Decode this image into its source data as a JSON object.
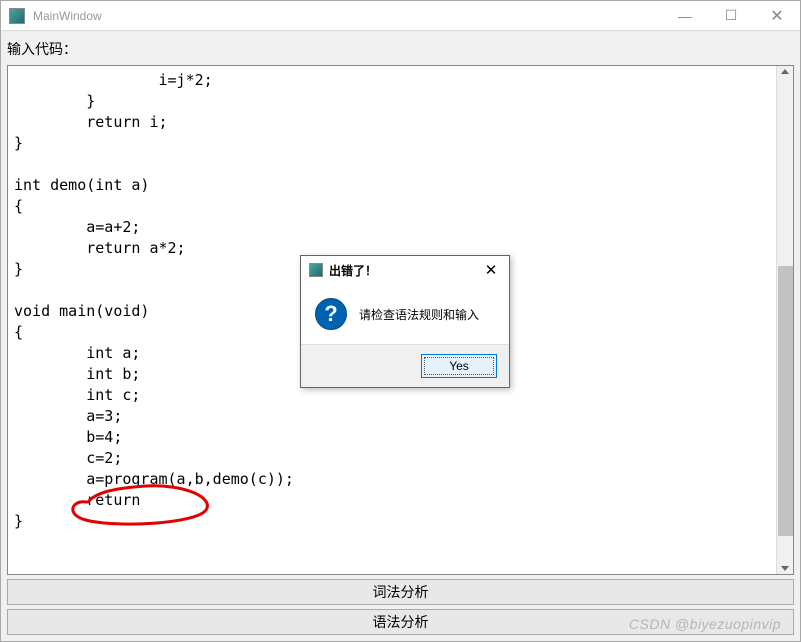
{
  "window": {
    "title": "MainWindow",
    "min_label": "—",
    "max_label": "☐",
    "close_label": "✕"
  },
  "label": "输入代码：",
  "code": "                i=j*2;\n        }\n        return i;\n}\n\nint demo(int a)\n{\n        a=a+2;\n        return a*2;\n}\n\nvoid main(void)\n{\n        int a;\n        int b;\n        int c;\n        a=3;\n        b=4;\n        c=2;\n        a=program(a,b,demo(c));\n        return\n}",
  "buttons": {
    "lexical": "词法分析",
    "syntax": "语法分析"
  },
  "dialog": {
    "title": "出错了！",
    "close": "✕",
    "icon_glyph": "?",
    "message": "请检查语法规则和输入",
    "yes": "Yes"
  },
  "watermark": "CSDN @biyezuopinvip"
}
